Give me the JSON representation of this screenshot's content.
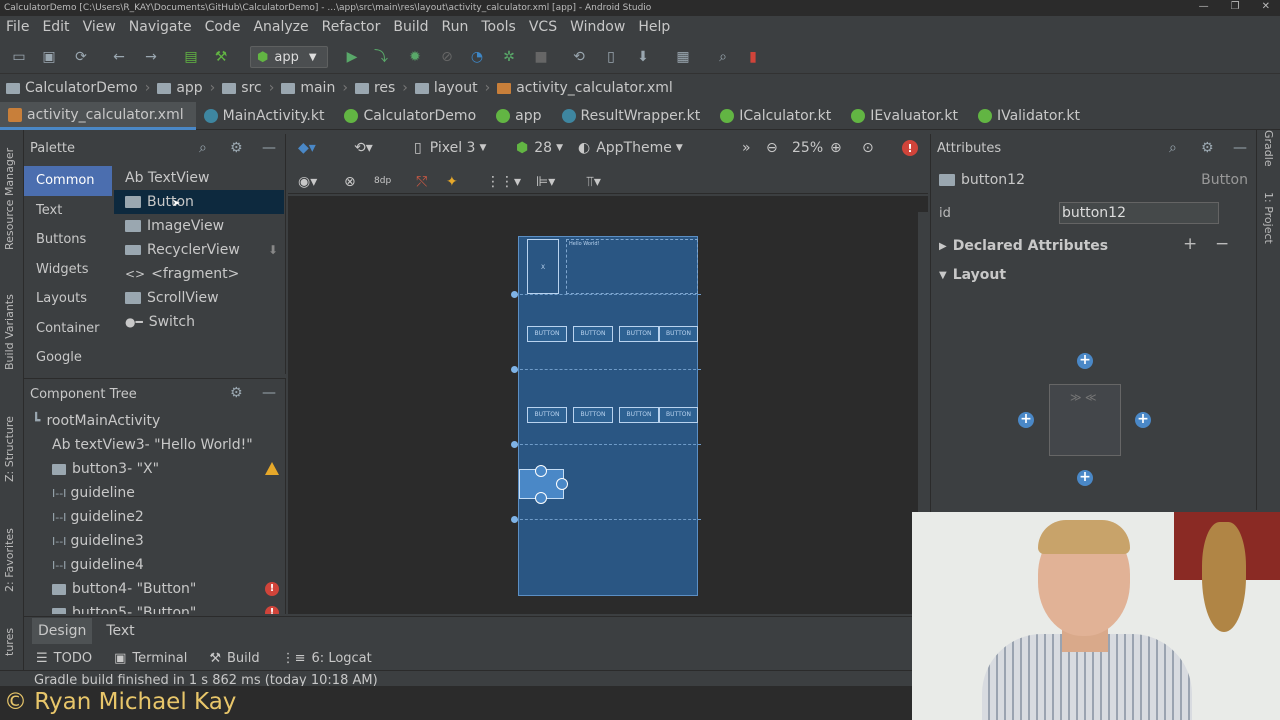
{
  "window": {
    "title": "CalculatorDemo [C:\\Users\\R_KAY\\Documents\\GitHub\\CalculatorDemo] - ...\\app\\src\\main\\res\\layout\\activity_calculator.xml [app] - Android Studio"
  },
  "menu": [
    "File",
    "Edit",
    "View",
    "Navigate",
    "Code",
    "Analyze",
    "Refactor",
    "Build",
    "Run",
    "Tools",
    "VCS",
    "Window",
    "Help"
  ],
  "toolbar": {
    "run_config": "app"
  },
  "breadcrumb": [
    "CalculatorDemo",
    "app",
    "src",
    "main",
    "res",
    "layout",
    "activity_calculator.xml"
  ],
  "tabs": [
    "activity_calculator.xml",
    "MainActivity.kt",
    "CalculatorDemo",
    "app",
    "ResultWrapper.kt",
    "ICalculator.kt",
    "IEvaluator.kt",
    "IValidator.kt"
  ],
  "left_strip": [
    "Resource Manager",
    "Build Variants",
    "Z: Structure",
    "2: Favorites",
    "tures"
  ],
  "right_strip": [
    "Gradle",
    "1: Project"
  ],
  "palette": {
    "title": "Palette",
    "categories": [
      "Common",
      "Text",
      "Buttons",
      "Widgets",
      "Layouts",
      "Container",
      "Google"
    ],
    "selected_category": "Common",
    "items": [
      "Ab TextView",
      "Button",
      "ImageView",
      "RecyclerView",
      "<fragment>",
      "ScrollView",
      "Switch"
    ],
    "selected_item": "Button"
  },
  "component_tree": {
    "title": "Component Tree",
    "rows": [
      {
        "label": "rootMainActivity",
        "indent": 0,
        "flag": ""
      },
      {
        "label": "Ab textView3- \"Hello World!\"",
        "indent": 1,
        "flag": ""
      },
      {
        "label": "button3- \"X\"",
        "indent": 1,
        "flag": "warning"
      },
      {
        "label": "guideline",
        "indent": 1,
        "flag": ""
      },
      {
        "label": "guideline2",
        "indent": 1,
        "flag": ""
      },
      {
        "label": "guideline3",
        "indent": 1,
        "flag": ""
      },
      {
        "label": "guideline4",
        "indent": 1,
        "flag": ""
      },
      {
        "label": "button4- \"Button\"",
        "indent": 1,
        "flag": "error"
      },
      {
        "label": "button5- \"Button\"",
        "indent": 1,
        "flag": "error"
      }
    ]
  },
  "design_toolbar": {
    "device": "Pixel 3",
    "api": "28",
    "theme": "AppTheme",
    "zoom": "25%",
    "margin": "8dp"
  },
  "phone": {
    "hello_text": "Hello World!",
    "x_text": "X",
    "row1_buttons": [
      "BUTTON",
      "BUTTON",
      "BUTTON",
      "BUTTON"
    ],
    "row2_buttons": [
      "BUTTON",
      "BUTTON",
      "BUTTON",
      "BUTTON"
    ]
  },
  "bottom_tabs": [
    "Design",
    "Text"
  ],
  "active_bottom_tab": "Design",
  "tool_windows": [
    "TODO",
    "Terminal",
    "Build",
    "6: Logcat"
  ],
  "status": "Gradle build finished in 1 s 862 ms (today 10:18 AM)",
  "attributes": {
    "title": "Attributes",
    "component_name": "button12",
    "component_type": "Button",
    "id_label": "id",
    "id_value": "button12",
    "sections": [
      "Declared Attributes",
      "Layout"
    ]
  },
  "copyright": "© Ryan Michael Kay",
  "colors": {
    "accent": "#4a88c7",
    "selection": "#4b6eaf",
    "blueprint": "#2a5683",
    "copyright": "#e8c66a"
  }
}
